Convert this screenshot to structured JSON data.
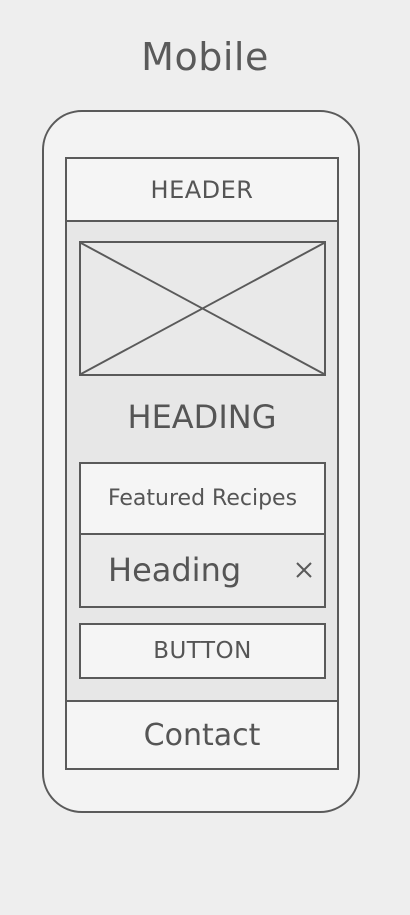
{
  "title": "Mobile",
  "header": {
    "label": "HEADER"
  },
  "image": {
    "icon": "image-placeholder-icon"
  },
  "heading": "HEADING",
  "card": {
    "title": "Featured Recipes",
    "row_label": "Heading",
    "row_icon": "close-icon"
  },
  "button": {
    "label": "BUTTON"
  },
  "footer": {
    "label": "Contact"
  },
  "colors": {
    "stroke": "#5a5a5a",
    "background": "#eeeeee",
    "fill": "#f5f5f5"
  }
}
